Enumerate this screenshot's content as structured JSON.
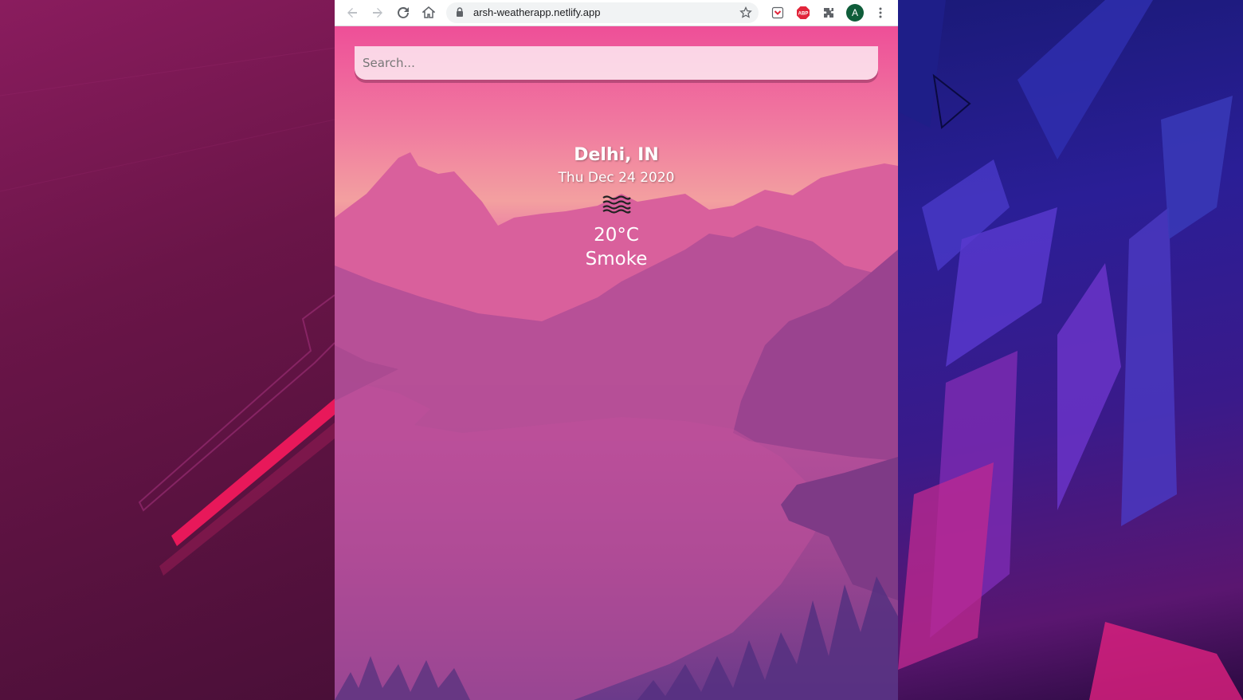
{
  "browser": {
    "url": "arsh-weatherapp.netlify.app",
    "profile_initial": "A",
    "extensions": [
      "pocket-icon",
      "adblock-icon",
      "puzzle-icon"
    ]
  },
  "search": {
    "placeholder": "Search...",
    "value": ""
  },
  "weather": {
    "location": "Delhi, IN",
    "date": "Thu Dec 24 2020",
    "icon": "mist-icon",
    "temperature": "20°C",
    "description": "Smoke"
  },
  "colors": {
    "sky_top": "#ee4f98",
    "horizon": "#f3a0a0",
    "mountains": "#b04d98",
    "accent_left": "#e8185a",
    "desktop_right": "#2a1e96"
  }
}
